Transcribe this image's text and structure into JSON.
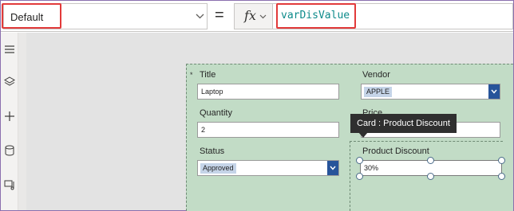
{
  "formula_bar": {
    "property": "Default",
    "equals": "=",
    "fx_label": "fx",
    "formula": "varDisValue"
  },
  "left_rail": {
    "icons": [
      "hamburger-icon",
      "layers-icon",
      "plus-icon",
      "database-icon",
      "media-icon"
    ]
  },
  "form": {
    "required_marker": "*",
    "title": {
      "label": "Title",
      "value": "Laptop"
    },
    "vendor": {
      "label": "Vendor",
      "value": "APPLE"
    },
    "quantity": {
      "label": "Quantity",
      "value": "2"
    },
    "price": {
      "label": "Price"
    },
    "status": {
      "label": "Status",
      "value": "Approved"
    },
    "product_discount": {
      "label": "Product Discount",
      "value": "30%"
    }
  },
  "tooltip": {
    "text": "Card : Product Discount"
  },
  "colors": {
    "highlight": "#e23a3a",
    "form_bg": "#c2dcc6",
    "formula_text": "#0c8a8a",
    "dropdown_button": "#27549a",
    "tooltip_bg": "#2f2f2f"
  }
}
